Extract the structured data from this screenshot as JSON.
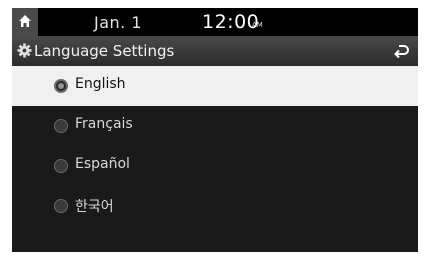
{
  "status_bar": {
    "date": "Jan.  1",
    "time": "12:00",
    "ampm": "AM"
  },
  "title_bar": {
    "title": "Language Settings",
    "icon": "gear-icon",
    "back_icon": "back-arrow-icon"
  },
  "languages": [
    {
      "label": "English",
      "selected": true
    },
    {
      "label": "Français",
      "selected": false
    },
    {
      "label": "Español",
      "selected": false
    },
    {
      "label": "한국어",
      "selected": false
    }
  ],
  "colors": {
    "screen_bg": "#1a1a1a",
    "selected_row_bg": "#f0f0f0"
  }
}
